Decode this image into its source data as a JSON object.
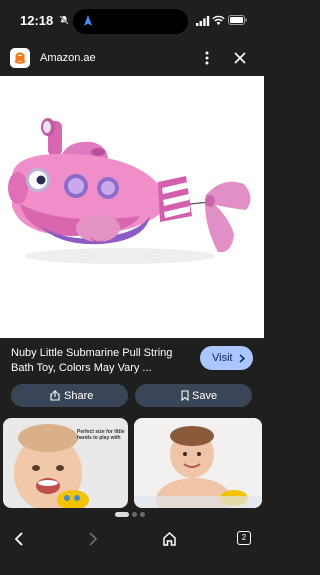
{
  "status_bar": {
    "time": "12:18",
    "icons": [
      "bell-slash-icon",
      "navigation-arrow-icon",
      "signal-icon",
      "wifi-icon",
      "battery-icon"
    ],
    "nav_arrow_color": "#4a8cff"
  },
  "header": {
    "site_name": "Amazon.ae",
    "site_logo_icon": "amazon-logo-icon",
    "logo_color": "#f5781f",
    "menu_icon": "more-vertical-icon",
    "close_icon": "close-icon"
  },
  "product": {
    "title": "Nuby Little Submarine Pull String Bath Toy, Colors May Vary ...",
    "image_alt_icon": "pink-submarine-toy-image"
  },
  "visit_button": {
    "label": "Visit",
    "icon": "chevron-right-icon",
    "color": "#aac7ff"
  },
  "actions": {
    "share_label": "Share",
    "share_icon": "share-icon",
    "save_label": "Save",
    "save_icon": "bookmark-icon",
    "button_color": "#3a4657"
  },
  "related": {
    "caption_1": "Perfect size for little hands to play with"
  },
  "bottom_nav": {
    "back_icon": "chevron-left-icon",
    "forward_icon": "chevron-right-icon",
    "home_icon": "home-icon",
    "tab_count": "2"
  }
}
